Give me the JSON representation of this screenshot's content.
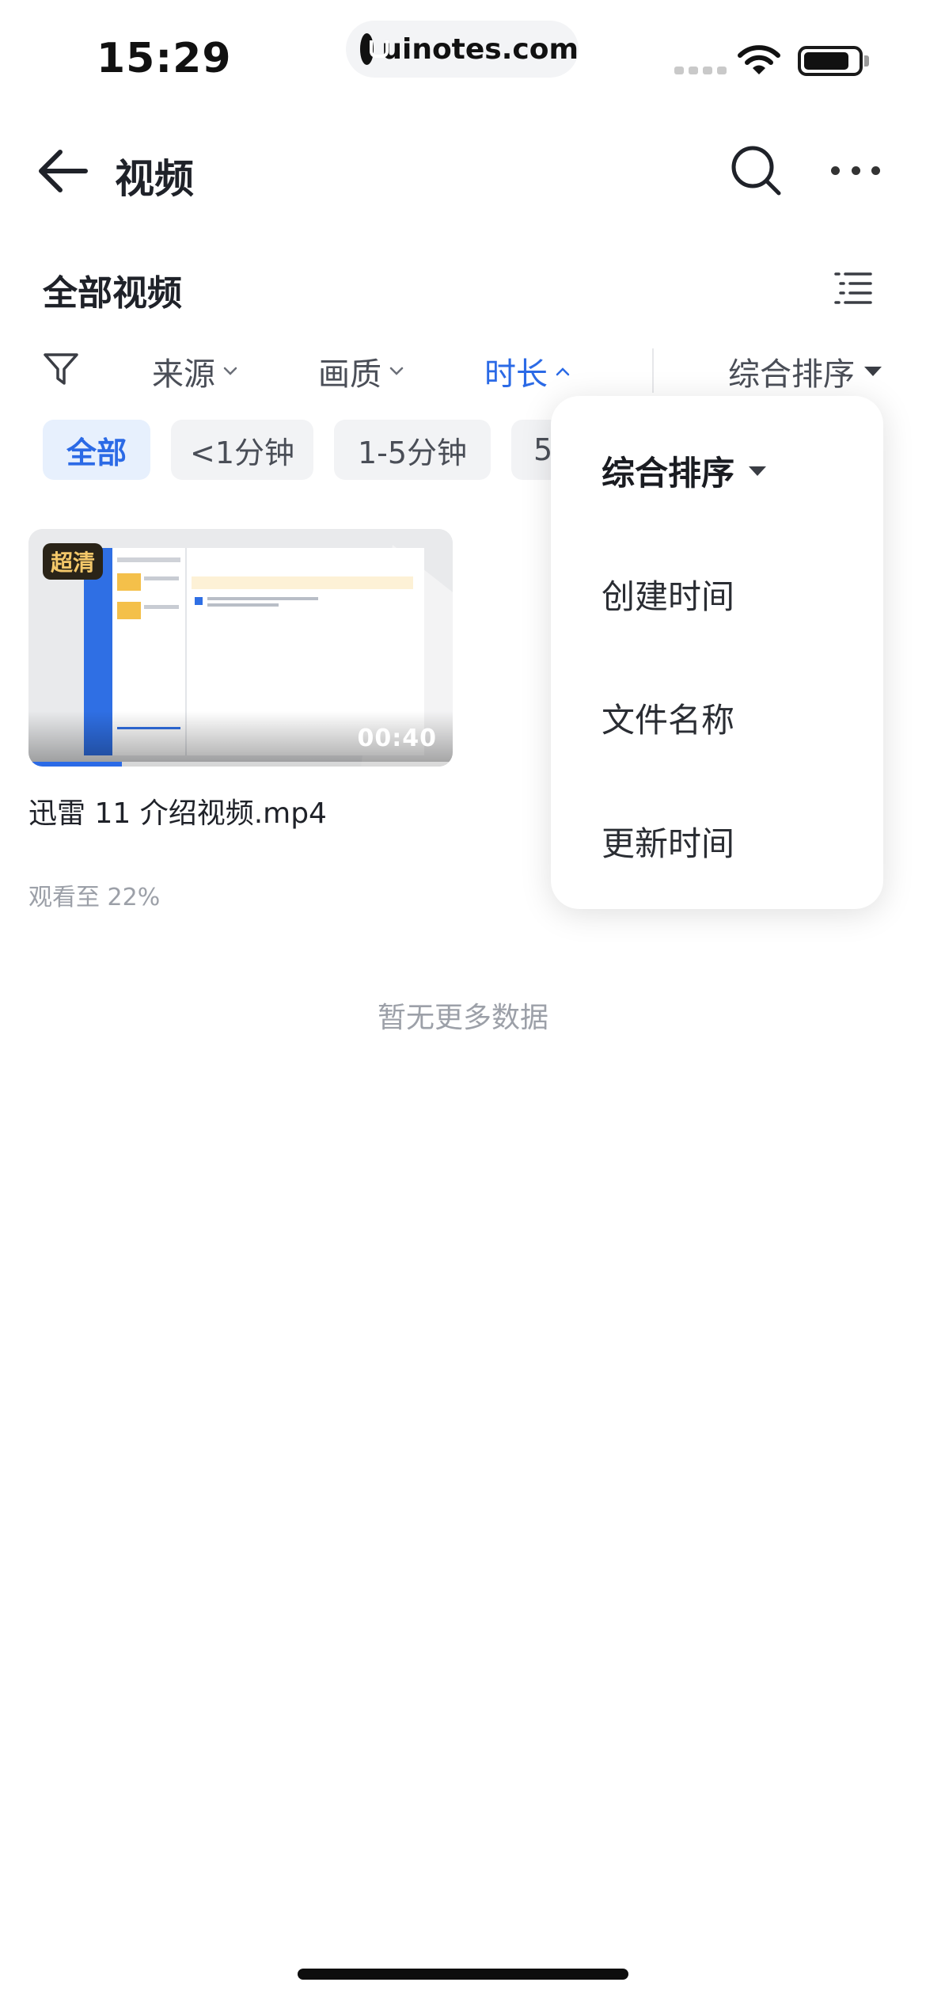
{
  "status_bar": {
    "time": "15:29",
    "url": "uinotes.com"
  },
  "header": {
    "title": "视频"
  },
  "section": {
    "title": "全部视频"
  },
  "filters": {
    "source": "来源",
    "quality": "画质",
    "duration": "时长",
    "sort": "综合排序"
  },
  "chips": [
    "全部",
    "<1分钟",
    "1-5分钟",
    "5"
  ],
  "video": {
    "quality_badge": "超清",
    "duration": "00:40",
    "title": "迅雷 11 介绍视频.mp4",
    "watch_progress": "观看至 22%",
    "progress_fraction": 0.22
  },
  "empty_state": "暂无更多数据",
  "sort_menu": {
    "items": [
      "综合排序",
      "创建时间",
      "文件名称",
      "更新时间"
    ]
  },
  "colors": {
    "accent": "#2b6ae6",
    "badge_bg": "#2a2418",
    "badge_text": "#f4c86a"
  }
}
